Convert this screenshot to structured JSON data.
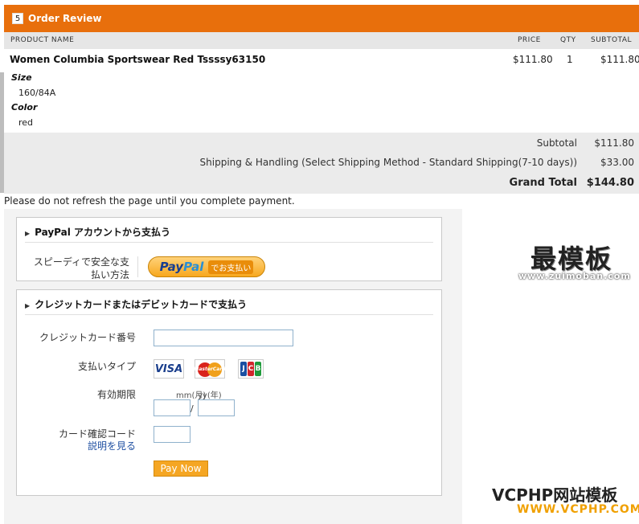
{
  "header": {
    "step": "5",
    "title": "Order Review"
  },
  "table": {
    "columns": {
      "product": "PRODUCT NAME",
      "price": "PRICE",
      "qty": "QTY",
      "subtotal": "SUBTOTAL"
    },
    "item": {
      "name": "Women Columbia Sportswear Red Tssssy63150",
      "price": "$111.80",
      "qty": "1",
      "subtotal": "$111.80",
      "options": [
        {
          "label": "Size",
          "value": "160/84A"
        },
        {
          "label": "Color",
          "value": "red"
        }
      ]
    }
  },
  "totals": {
    "subtotal_label": "Subtotal",
    "subtotal_value": "$111.80",
    "shipping_label": "Shipping & Handling (Select Shipping Method - Standard Shipping(7-10 days))",
    "shipping_value": "$33.00",
    "grand_label": "Grand Total",
    "grand_value": "$144.80"
  },
  "notice": "Please do not refresh the page until you complete payment.",
  "paypal": {
    "title": "PayPal アカウントから支払う",
    "desc_line1": "スピーディで安全な支",
    "desc_line2": "払い方法",
    "button_logo_a": "Pay",
    "button_logo_b": "Pal",
    "button_sub": "でお支払い"
  },
  "credit": {
    "title": "クレジットカードまたはデビットカードで支払う",
    "card_number_label": "クレジットカード番号",
    "card_type_label": "支払いタイプ",
    "cards": {
      "visa": "VISA",
      "mastercard": "MasterCard",
      "jcb_j": "J",
      "jcb_c": "C",
      "jcb_b": "B"
    },
    "expiry_label": "有効期限",
    "month_label": "mm(月)",
    "year_label": "yy(年)",
    "slash": "/",
    "cvv_label": "カード確認コード",
    "help_link": "説明を見る",
    "pay_button": "Pay Now",
    "colors": {
      "accent": "#e86f0c",
      "pay_button": "#f5a623"
    }
  },
  "watermarks": {
    "zuimoban_text": "最模板",
    "zuimoban_url": "www.zuimoban.com",
    "vcphp_text": "VCPHP网站模板",
    "vcphp_url": "WWW.VCPHP.COM"
  }
}
